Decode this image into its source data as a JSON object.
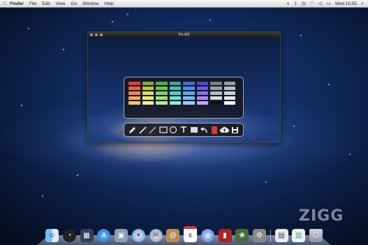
{
  "menubar": {
    "apple_icon": "apple-logo",
    "items": [
      "Finder",
      "File",
      "Edit",
      "View",
      "Go",
      "Window",
      "Help"
    ],
    "clock": "Wed 10:55"
  },
  "window": {
    "title": "Pix.AM"
  },
  "palette": {
    "colors": [
      "#d9423a",
      "#8aa83b",
      "#58a84a",
      "#3fa3a0",
      "#3f6fcf",
      "#4a4ad0",
      "#7d7d7d",
      "#9e9e9e",
      "#e9643f",
      "#b6c33c",
      "#6fc04c",
      "#43bdb5",
      "#4d8ee6",
      "#6a5ae6",
      "#a0a0a0",
      "#bdbdbd",
      "#f2884a",
      "#dfe04a",
      "#86d65a",
      "#4fd6c8",
      "#5aa8f2",
      "#8a70ef",
      "#bcbcbc",
      "#d3d3d3",
      "#f4a653",
      "#ecec6a",
      "#9ee46b",
      "#6ae3d3",
      "#73baf6",
      "#a98cf2",
      "#d8d8d8",
      "#e7e7e7",
      "#f6c36b",
      "#f2f28c",
      "#b7ec8a",
      "#8ceadc",
      "#98cdf8",
      "#c2a9f5",
      "#111111",
      "#f7f7f7"
    ]
  },
  "toolbar": {
    "tools": [
      "pencil-icon",
      "brush-icon",
      "line-icon",
      "rectangle-icon",
      "ellipse-icon",
      "text-icon",
      "fill-rect-icon",
      "undo-icon",
      "color-well-icon",
      "upload-cloud-icon",
      "save-icon"
    ],
    "current_color": "#e23a2a"
  },
  "watermark": "ZIGG",
  "dock": {
    "calendar_day": "6",
    "icons": [
      "finder",
      "dashboard",
      "mission-control",
      "app-store",
      "preview",
      "safari",
      "mail",
      "address-book",
      "ical",
      "itunes",
      "photo-booth",
      "iphoto",
      "system-preferences",
      "applications",
      "documents",
      "trash"
    ]
  }
}
